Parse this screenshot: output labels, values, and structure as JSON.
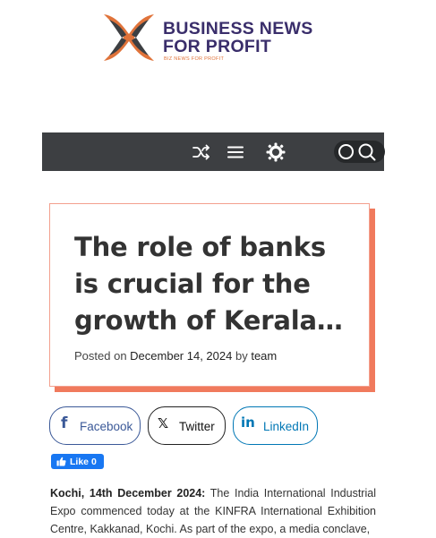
{
  "brand": {
    "name_line1": "BUSINESS NEWS",
    "name_line2": "FOR PROFIT",
    "tagline": "BIZ NEWS FOR PROFIT",
    "colors": {
      "navy": "#3a2e6b",
      "orange": "#e0733a",
      "dark": "#3d3f42"
    }
  },
  "navbar": {
    "icons": [
      "shuffle-icon",
      "menu-icon",
      "sun-icon",
      "dark-mode-toggle",
      "search-icon"
    ],
    "background": "#3d3f42"
  },
  "post": {
    "title": "The role of banks is crucial for the growth of Kerala…",
    "meta_prefix": "Posted on",
    "date": "December 14, 2024",
    "meta_by": "by",
    "author": "team",
    "accent": "#f07a5d"
  },
  "share": {
    "facebook_label": "Facebook",
    "twitter_label": "Twitter",
    "linkedin_label": "LinkedIn"
  },
  "like": {
    "label": "Like",
    "count": "0"
  },
  "article": {
    "lead": "Kochi, 14th December 2024:",
    "body": " The India International Industrial Expo commenced today at the KINFRA International Exhibition Centre, Kakkanad, Kochi. As part of the expo, a media conclave,"
  }
}
